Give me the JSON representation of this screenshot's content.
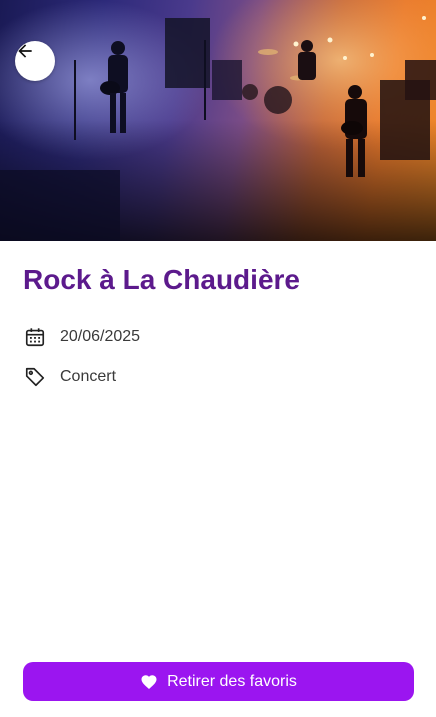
{
  "event": {
    "title": "Rock à La Chaudière",
    "date": "20/06/2025",
    "category": "Concert"
  },
  "actions": {
    "favorite_label": "Retirer des favoris"
  },
  "icons": {
    "back": "arrow-left-icon",
    "date": "calendar-icon",
    "category": "tag-icon",
    "favorite": "heart-icon"
  },
  "colors": {
    "title": "#5c1a8c",
    "button": "#9b15f0",
    "button_text": "#ffffff"
  }
}
